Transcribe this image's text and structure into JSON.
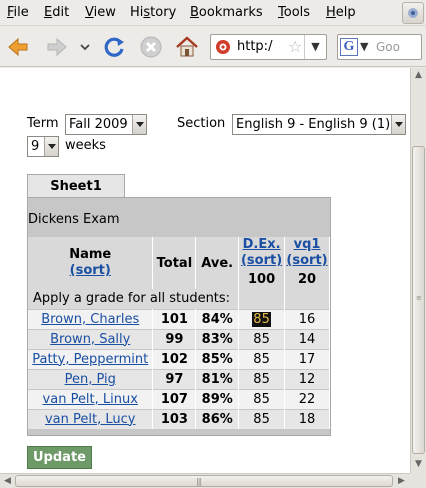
{
  "menu": {
    "items": [
      {
        "u": "F",
        "rest": "ile"
      },
      {
        "u": "E",
        "rest": "dit"
      },
      {
        "u": "V",
        "rest": "iew"
      },
      {
        "u": "",
        "pre": "Hi",
        "u2": "s",
        "rest": "tory"
      },
      {
        "u": "B",
        "rest": "ookmarks"
      },
      {
        "u": "T",
        "rest": "ools"
      },
      {
        "u": "H",
        "rest": "elp"
      }
    ]
  },
  "toolbar": {
    "url_text": "http:/",
    "search_placeholder": "Goo",
    "search_engine_letter": "G"
  },
  "icons": [
    "back-arrow-icon",
    "forward-arrow-icon",
    "history-dropdown-icon",
    "reload-icon",
    "stop-icon",
    "home-icon",
    "site-favicon",
    "bookmark-star-icon"
  ],
  "form": {
    "term_label": "Term",
    "term_value": "Fall 2009",
    "section_label": "Section",
    "section_value": "English 9 - English 9 (1)",
    "weeks_value": "9",
    "weeks_label": "weeks"
  },
  "sheet": {
    "tab_label": "Sheet1",
    "title": "Dickens Exam",
    "headers": {
      "name": "Name",
      "name_sort": "(sort)",
      "total": "Total",
      "ave": "Ave.",
      "col1": "D.Ex.",
      "col1_sort": "(sort)",
      "col2": "vq1",
      "col2_sort": "(sort)",
      "col1_points": "100",
      "col2_points": "20"
    },
    "apply_label": "Apply a grade for all students:",
    "students": [
      {
        "name": "Brown, Charles",
        "total": "101",
        "ave": "84%",
        "dex": "85",
        "vq1": "16"
      },
      {
        "name": "Brown, Sally",
        "total": "99",
        "ave": "83%",
        "dex": "85",
        "vq1": "14"
      },
      {
        "name": "Patty, Peppermint",
        "total": "102",
        "ave": "85%",
        "dex": "85",
        "vq1": "17"
      },
      {
        "name": "Pen, Pig",
        "total": "97",
        "ave": "81%",
        "dex": "85",
        "vq1": "12"
      },
      {
        "name": "van Pelt, Linux",
        "total": "107",
        "ave": "89%",
        "dex": "85",
        "vq1": "22"
      },
      {
        "name": "van Pelt, Lucy",
        "total": "103",
        "ave": "86%",
        "dex": "85",
        "vq1": "18"
      }
    ]
  },
  "update_label": "Update",
  "colors": {
    "link": "#1a4fa3",
    "update_button": "#6d9a67",
    "highlight_bg": "#111111",
    "highlight_fg": "#e8b84a"
  }
}
